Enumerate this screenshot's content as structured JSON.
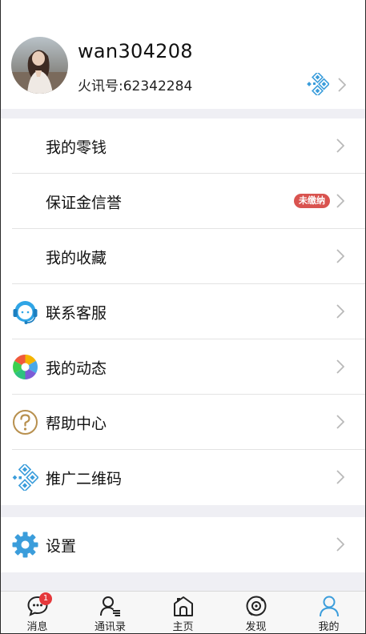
{
  "profile": {
    "username": "wan304208",
    "account_label": "火讯号:62342284"
  },
  "menu": {
    "wallet": "我的零钱",
    "deposit": "保证金信誉",
    "deposit_badge": "未缴纳",
    "favorites": "我的收藏",
    "service": "联系客服",
    "moments": "我的动态",
    "help": "帮助中心",
    "promo_qr": "推广二维码",
    "settings": "设置"
  },
  "tabbar": {
    "messages": "消息",
    "messages_badge": "1",
    "contacts": "通讯录",
    "home": "主页",
    "discover": "发现",
    "me": "我的"
  },
  "colors": {
    "accent": "#3b9ddb",
    "badge": "#d9534f",
    "gap": "#efeff4"
  }
}
